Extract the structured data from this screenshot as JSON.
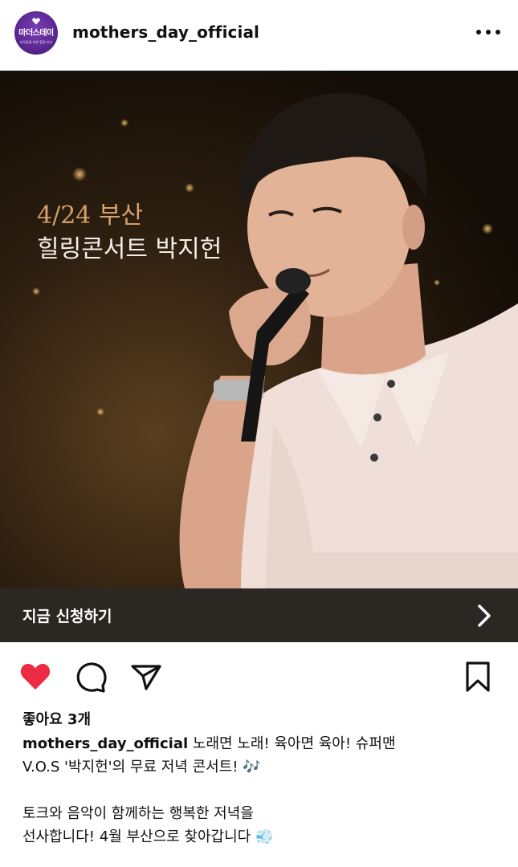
{
  "header": {
    "username": "mothers_day_official",
    "avatar_text": "마더스데이",
    "avatar_subtext": "부모들을 위한 힐링 파티",
    "more_icon": "more-horizontal-icon"
  },
  "post": {
    "promo_date": "4/24 부산",
    "promo_title": "힐링콘서트 박지헌",
    "cta_label": "지금 신청하기",
    "cta_icon": "chevron-right-icon"
  },
  "actions": {
    "like_icon": "heart-filled-icon",
    "comment_icon": "comment-icon",
    "share_icon": "share-icon",
    "save_icon": "bookmark-icon",
    "like_color": "#ed4956"
  },
  "meta": {
    "likes_label": "좋아요",
    "likes_count": "3개"
  },
  "caption": {
    "username": "mothers_day_official",
    "line1": " 노래면 노래! 육아면 육아! 슈퍼맨",
    "line2": " V.O.S '박지헌'의 무료 저녁 콘서트! 🎶",
    "line3": "토크와 음악이 함께하는 행복한 저녁을",
    "line4": "선사합니다! 4월 부산으로 찾아갑니다 💨"
  }
}
